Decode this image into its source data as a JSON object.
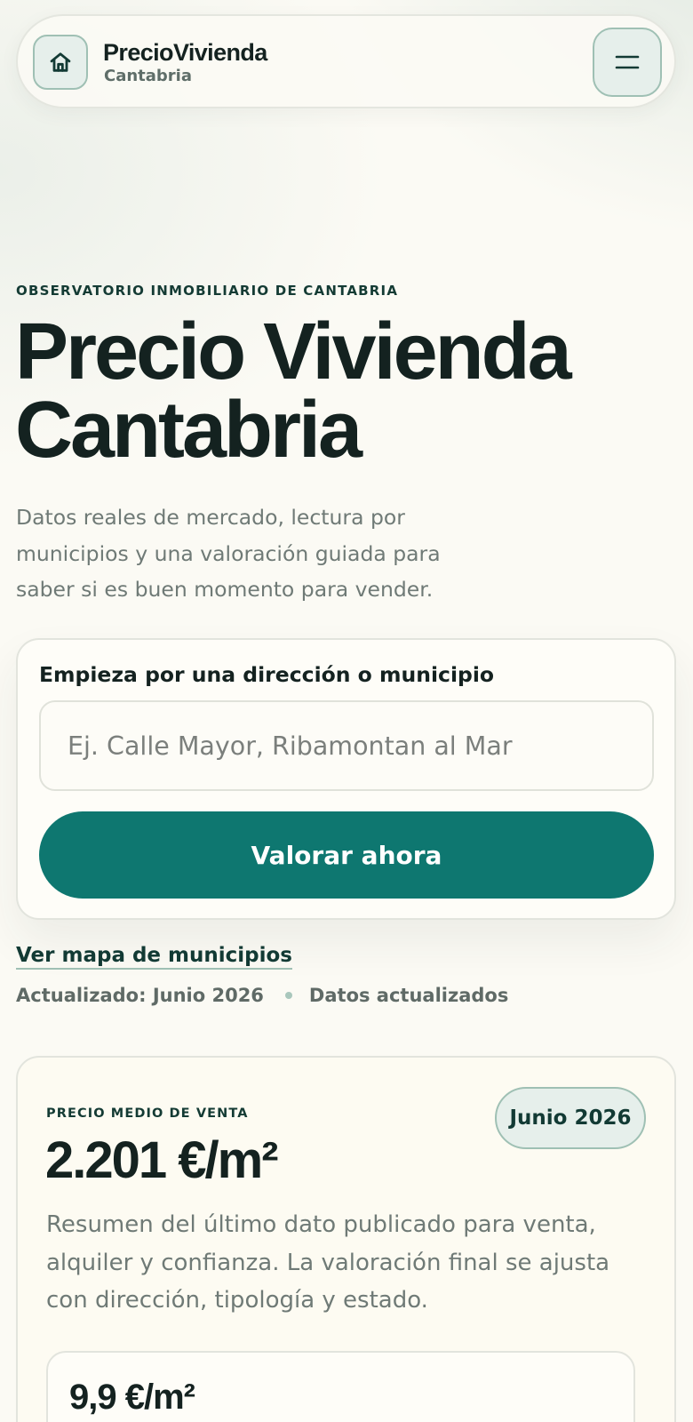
{
  "header": {
    "brand_name": "PrecioVivienda",
    "brand_sub": "Cantabria",
    "home_icon": "home-icon",
    "menu_icon": "menu-icon"
  },
  "hero": {
    "eyebrow": "OBSERVATORIO INMOBILIARIO DE CANTABRIA",
    "title_line1": "Precio Vivienda",
    "title_line2": "Cantabria",
    "description": "Datos reales de mercado, lectura por municipios y una valoración guiada para saber si es buen momento para vender."
  },
  "search": {
    "label": "Empieza por una dirección o municipio",
    "placeholder": "Ej. Calle Mayor, Ribamontan al Mar",
    "value": "",
    "cta_label": "Valorar ahora"
  },
  "links": {
    "map": "Ver mapa de municipios"
  },
  "meta": {
    "updated": "Actualizado: Junio 2026",
    "status": "Datos actualizados"
  },
  "price_card": {
    "eyebrow": "PRECIO MEDIO DE VENTA",
    "badge": "Junio 2026",
    "value": "2.201 €/m²",
    "description": "Resumen del último dato publicado para venta, alquiler y confianza. La valoración final se ajusta con dirección, tipología y estado.",
    "sub_value": "9,9 €/m²"
  },
  "colors": {
    "accent": "#0e7770",
    "text": "#142220",
    "muted": "#6f7a76",
    "background": "#fbfaf4"
  }
}
